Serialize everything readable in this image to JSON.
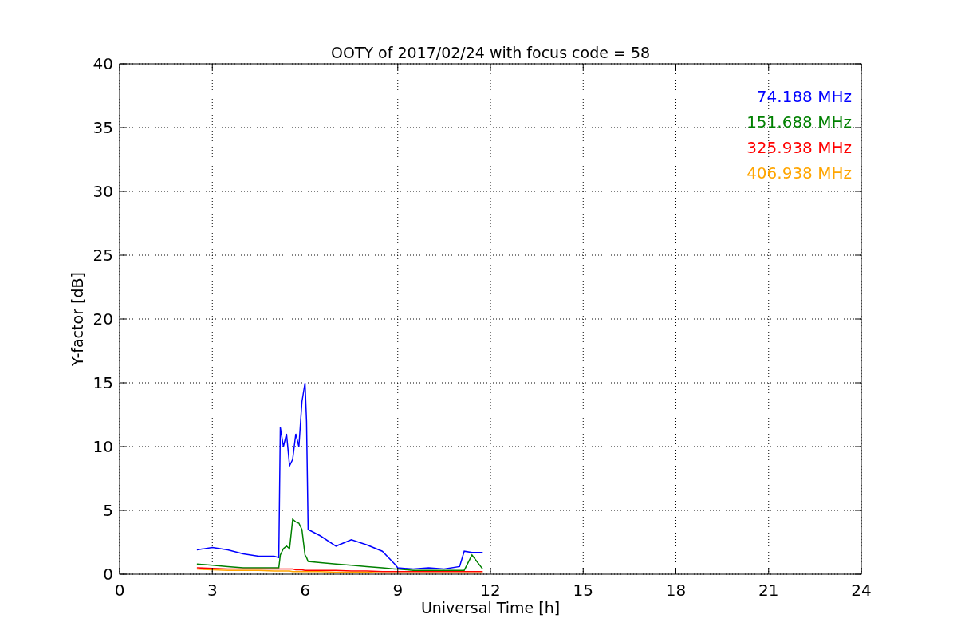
{
  "chart_data": {
    "type": "line",
    "title": "OOTY of 2017/02/24 with focus code = 58",
    "xlabel": "Universal Time [h]",
    "ylabel": "Y-factor [dB]",
    "x": [
      2.5,
      3,
      3.5,
      4,
      4.5,
      5,
      5.15,
      5.2,
      5.3,
      5.4,
      5.5,
      5.6,
      5.7,
      5.8,
      5.9,
      6,
      6.05,
      6.1,
      6.5,
      7,
      7.5,
      8,
      8.5,
      8.9,
      9,
      9.5,
      10,
      10.5,
      11,
      11.15,
      11.4,
      11.75
    ],
    "series": [
      {
        "name": "74.188 MHz",
        "color": "#0000ff",
        "values": [
          1.9,
          2.1,
          1.9,
          1.6,
          1.4,
          1.4,
          1.3,
          11.5,
          10,
          11,
          8.5,
          9,
          11,
          10,
          13.5,
          15,
          12,
          3.5,
          3,
          2.2,
          2.7,
          2.3,
          1.8,
          0.8,
          0.5,
          0.4,
          0.5,
          0.4,
          0.6,
          1.8,
          1.7,
          1.7
        ]
      },
      {
        "name": "151.688 MHz",
        "color": "#008000",
        "values": [
          0.8,
          0.7,
          0.6,
          0.5,
          0.5,
          0.5,
          0.5,
          1.5,
          2,
          2.2,
          2,
          4.3,
          4.1,
          4,
          3.5,
          1.5,
          1.3,
          1,
          0.9,
          0.8,
          0.7,
          0.6,
          0.5,
          0.4,
          0.4,
          0.3,
          0.3,
          0.3,
          0.3,
          0.3,
          1.5,
          0.4
        ]
      },
      {
        "name": "325.938 MHz",
        "color": "#ff0000",
        "values": [
          0.5,
          0.45,
          0.4,
          0.4,
          0.4,
          0.4,
          0.4,
          0.4,
          0.4,
          0.4,
          0.4,
          0.4,
          0.35,
          0.35,
          0.35,
          0.3,
          0.3,
          0.3,
          0.3,
          0.3,
          0.25,
          0.25,
          0.2,
          0.2,
          0.2,
          0.2,
          0.2,
          0.2,
          0.2,
          0.2,
          0.2,
          0.2
        ]
      },
      {
        "name": "406.938 MHz",
        "color": "#ffa500",
        "values": [
          0.4,
          0.35,
          0.3,
          0.3,
          0.3,
          0.25,
          0.25,
          0.25,
          0.25,
          0.25,
          0.25,
          0.2,
          0.2,
          0.2,
          0.2,
          0.2,
          0.2,
          0.2,
          0.2,
          0.15,
          0.15,
          0.15,
          0.1,
          0.1,
          0.1,
          0.1,
          0.1,
          0.1,
          0.1,
          0.1,
          0.1,
          0.1
        ]
      }
    ],
    "grid": true,
    "xlim": [
      0,
      24
    ],
    "ylim": [
      0,
      40
    ],
    "xticks": [
      0,
      3,
      6,
      9,
      12,
      15,
      18,
      21,
      24
    ],
    "yticks": [
      0,
      5,
      10,
      15,
      20,
      25,
      30,
      35,
      40
    ]
  }
}
